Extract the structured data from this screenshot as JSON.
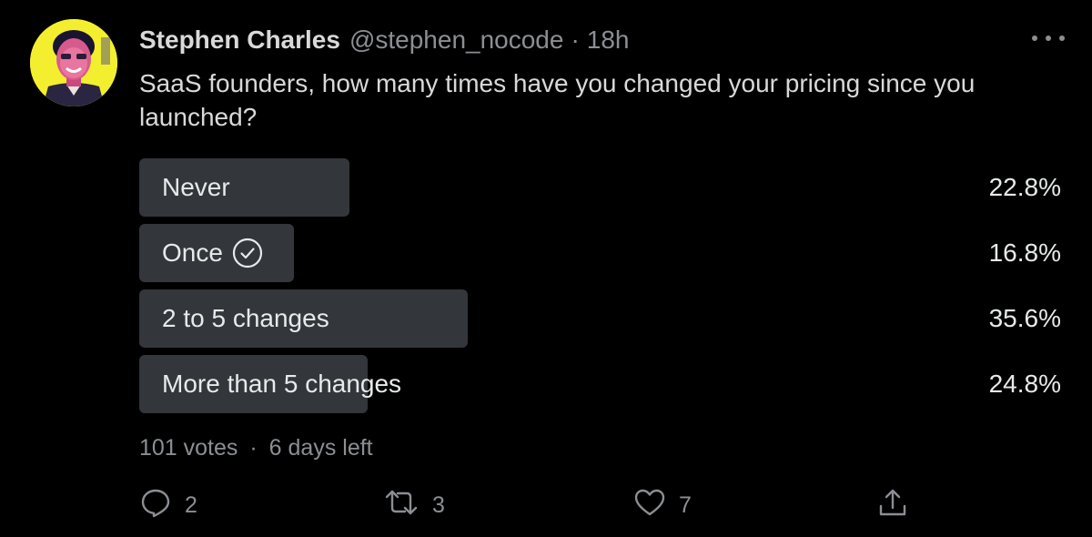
{
  "tweet": {
    "author_name": "Stephen Charles",
    "handle": "@stephen_nocode",
    "separator": "·",
    "time": "18h",
    "text": "SaaS founders, how many times have you changed your pricing since you launched?"
  },
  "poll": {
    "options": [
      {
        "label": "Never",
        "percent_text": "22.8%",
        "percent": 22.8
      },
      {
        "label": "Once",
        "percent_text": "16.8%",
        "percent": 16.8,
        "voted": true
      },
      {
        "label": "2 to 5 changes",
        "percent_text": "35.6%",
        "percent": 35.6
      },
      {
        "label": "More than 5 changes",
        "percent_text": "24.8%",
        "percent": 24.8
      }
    ],
    "votes": "101 votes",
    "separator": "·",
    "time_left": "6 days left"
  },
  "actions": {
    "reply_count": "2",
    "retweet_count": "3",
    "like_count": "7"
  },
  "colors": {
    "background": "#000000",
    "poll_fill": "#33363a",
    "secondary_text": "#8b8f93",
    "avatar_bg": "#f4ef2e"
  },
  "icons": {
    "more": "more-horizontal-icon",
    "voted": "check-circle-icon",
    "reply": "reply-icon",
    "retweet": "retweet-icon",
    "like": "heart-icon",
    "share": "share-icon"
  }
}
